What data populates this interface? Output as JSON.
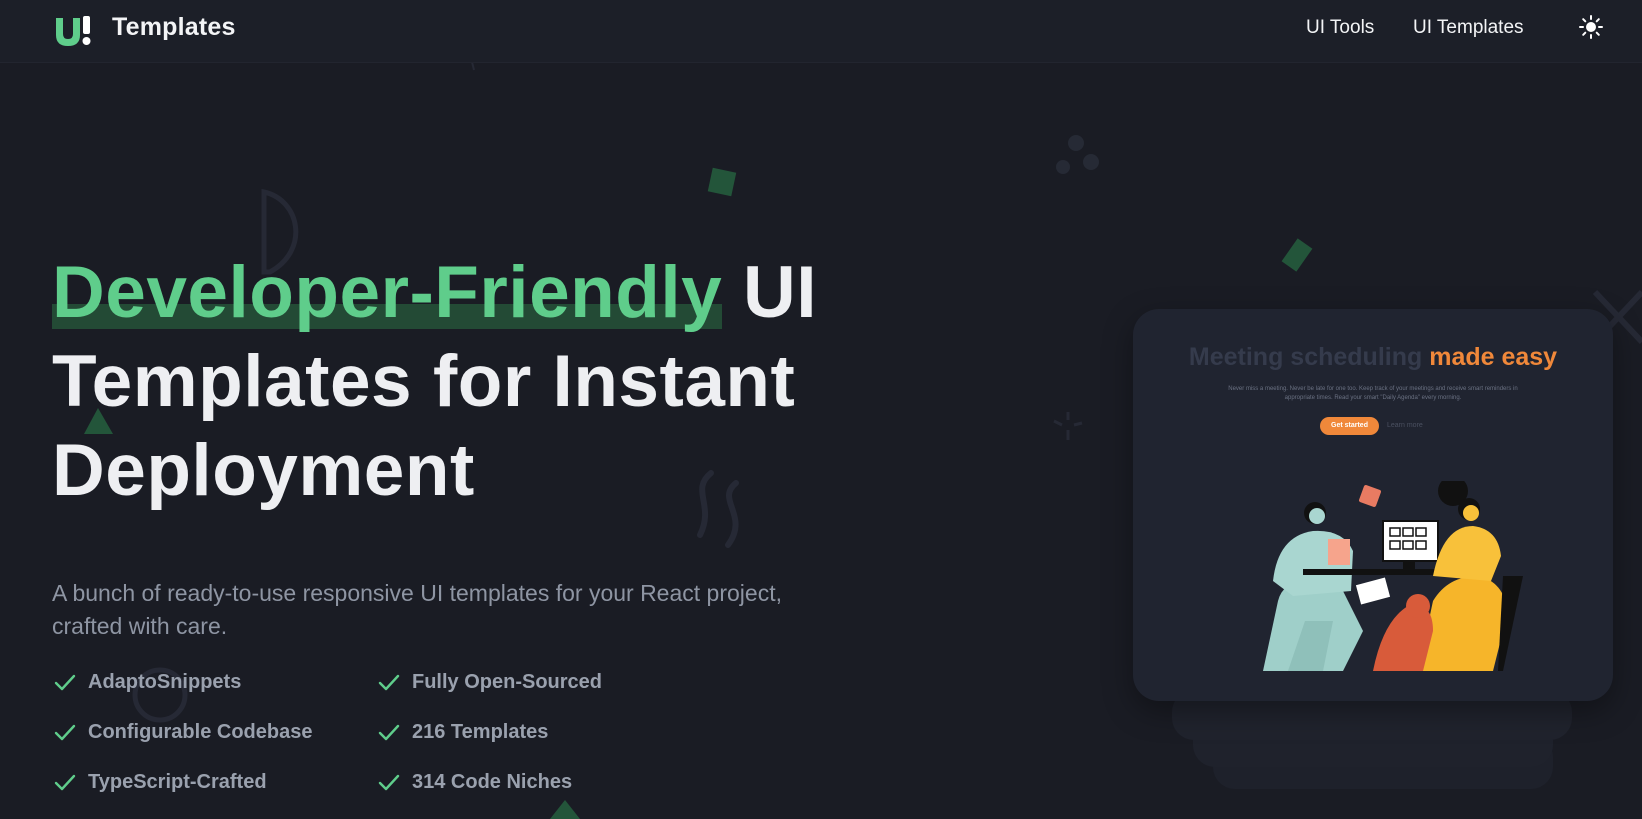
{
  "header": {
    "brand": "Templates",
    "nav": [
      "UI Tools",
      "UI Templates"
    ]
  },
  "hero": {
    "title_highlight": "Developer-Friendly",
    "title_line1_rest": "UI",
    "title_line2": "Templates for Instant",
    "title_line3": "Deployment",
    "description": "A bunch of ready-to-use responsive UI templates for your React project, crafted with care.",
    "features": [
      "AdaptoSnippets",
      "Fully Open-Sourced",
      "Configurable Codebase",
      "216 Templates",
      "TypeScript-Crafted",
      "314 Code Niches"
    ]
  },
  "preview": {
    "title_part1": "Meeting scheduling",
    "title_part2": "made easy",
    "text": "Never miss a meeting. Never be late for one too. Keep track of your meetings and receive smart reminders in appropriate times. Read your smart \"Daily Agenda\" every morning.",
    "primary_button": "Get started",
    "secondary_link": "Learn more"
  },
  "colors": {
    "background": "#1a1c24",
    "accent_green": "#5fcd8b",
    "highlight_bar": "#234a35",
    "accent_orange": "#f0883a"
  },
  "icons": {
    "logo": "ui-logo-icon",
    "theme": "sun-icon",
    "check": "check-icon"
  }
}
